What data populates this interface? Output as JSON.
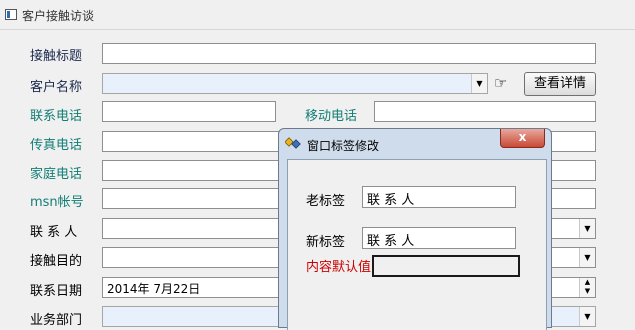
{
  "window": {
    "title": "客户接触访谈"
  },
  "form": {
    "contact_title": {
      "label": "接触标题",
      "value": ""
    },
    "customer_name": {
      "label": "客户名称",
      "value": ""
    },
    "view_details": "查看详情",
    "phone": {
      "label": "联系电话",
      "value": ""
    },
    "mobile": {
      "label": "移动电话",
      "value": ""
    },
    "fax": {
      "label": "传真电话",
      "value": ""
    },
    "home_phone": {
      "label": "家庭电话",
      "value": ""
    },
    "msn": {
      "label": "msn帐号",
      "value": ""
    },
    "contact_person": {
      "label": "联 系 人",
      "value": ""
    },
    "purpose": {
      "label": "接触目的",
      "value": ""
    },
    "contact_date": {
      "label": "联系日期",
      "value": "2014年  7月22日"
    },
    "department": {
      "label": "业务部门",
      "value": ""
    }
  },
  "dialog": {
    "title": "窗口标签修改",
    "close": "x",
    "old_label": {
      "label": "老标签",
      "value": "联 系 人"
    },
    "new_label": {
      "label": "新标签",
      "value": "联 系 人"
    },
    "default_label": "内容默认值",
    "colors": {
      "default_label": "#cc0000"
    }
  },
  "colors": {
    "label_dark": "#1c2a4d",
    "label_teal": "#127e75",
    "input_blue": "#e8f1fb"
  }
}
